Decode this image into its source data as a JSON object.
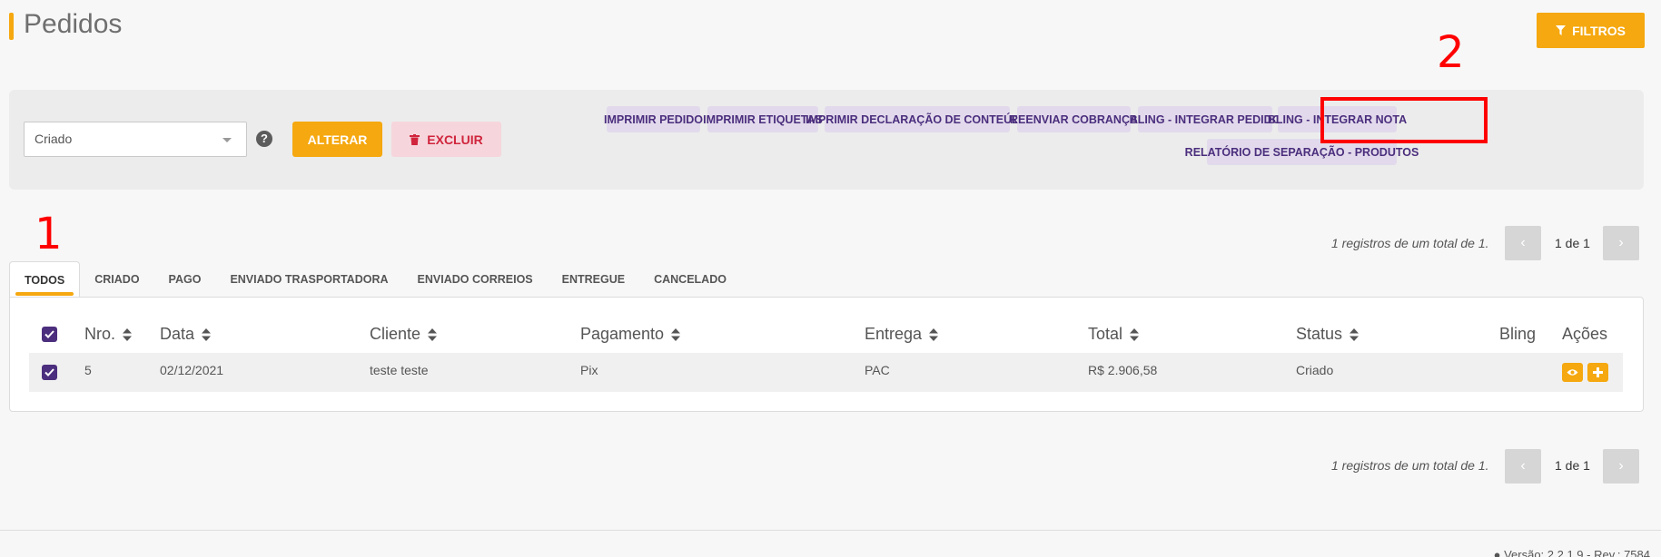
{
  "header": {
    "title": "Pedidos",
    "filter_label": "FILTROS"
  },
  "toolbar": {
    "status_value": "Criado",
    "help_symbol": "?",
    "alterar_label": "ALTERAR",
    "excluir_label": "EXCLUIR",
    "actions": [
      "IMPRIMIR PEDIDO",
      "IMPRIMIR ETIQUETAS",
      "IMPRIMIR DECLARAÇÃO DE CONTEÚDO",
      "REENVIAR COBRANÇA",
      "BLING - INTEGRAR PEDIDO",
      "BLING - INTEGRAR NOTA",
      "RELATÓRIO DE SEPARAÇÃO - PRODUTOS"
    ]
  },
  "annotations": {
    "one": "1",
    "two": "2"
  },
  "pagination": {
    "info": "1 registros de um total de 1.",
    "page": "1 de 1",
    "prev": "‹",
    "next": "›"
  },
  "tabs": [
    "TODOS",
    "CRIADO",
    "PAGO",
    "ENVIADO TRASPORTADORA",
    "ENVIADO CORREIOS",
    "ENTREGUE",
    "CANCELADO"
  ],
  "table": {
    "columns": [
      "Nro.",
      "Data",
      "Cliente",
      "Pagamento",
      "Entrega",
      "Total",
      "Status",
      "Bling",
      "Ações"
    ],
    "rows": [
      {
        "nro": "5",
        "data": "02/12/2021",
        "cliente": "teste teste",
        "pagamento": "Pix",
        "entrega": "PAC",
        "total": "R$ 2.906,58",
        "status": "Criado"
      }
    ]
  },
  "footer": {
    "version": "Versão: 2.2.1.9 - Rev.: 7584"
  },
  "colors": {
    "accent": "#f5a80f",
    "purple": "#4b2e7d",
    "danger": "#d0253d",
    "annotation": "#ff0000"
  },
  "icons": {
    "filter": "filter-icon",
    "trash": "trash-icon",
    "sort": "sort-icon",
    "eye": "eye-icon",
    "plus": "plus-icon",
    "info": "info-icon"
  }
}
